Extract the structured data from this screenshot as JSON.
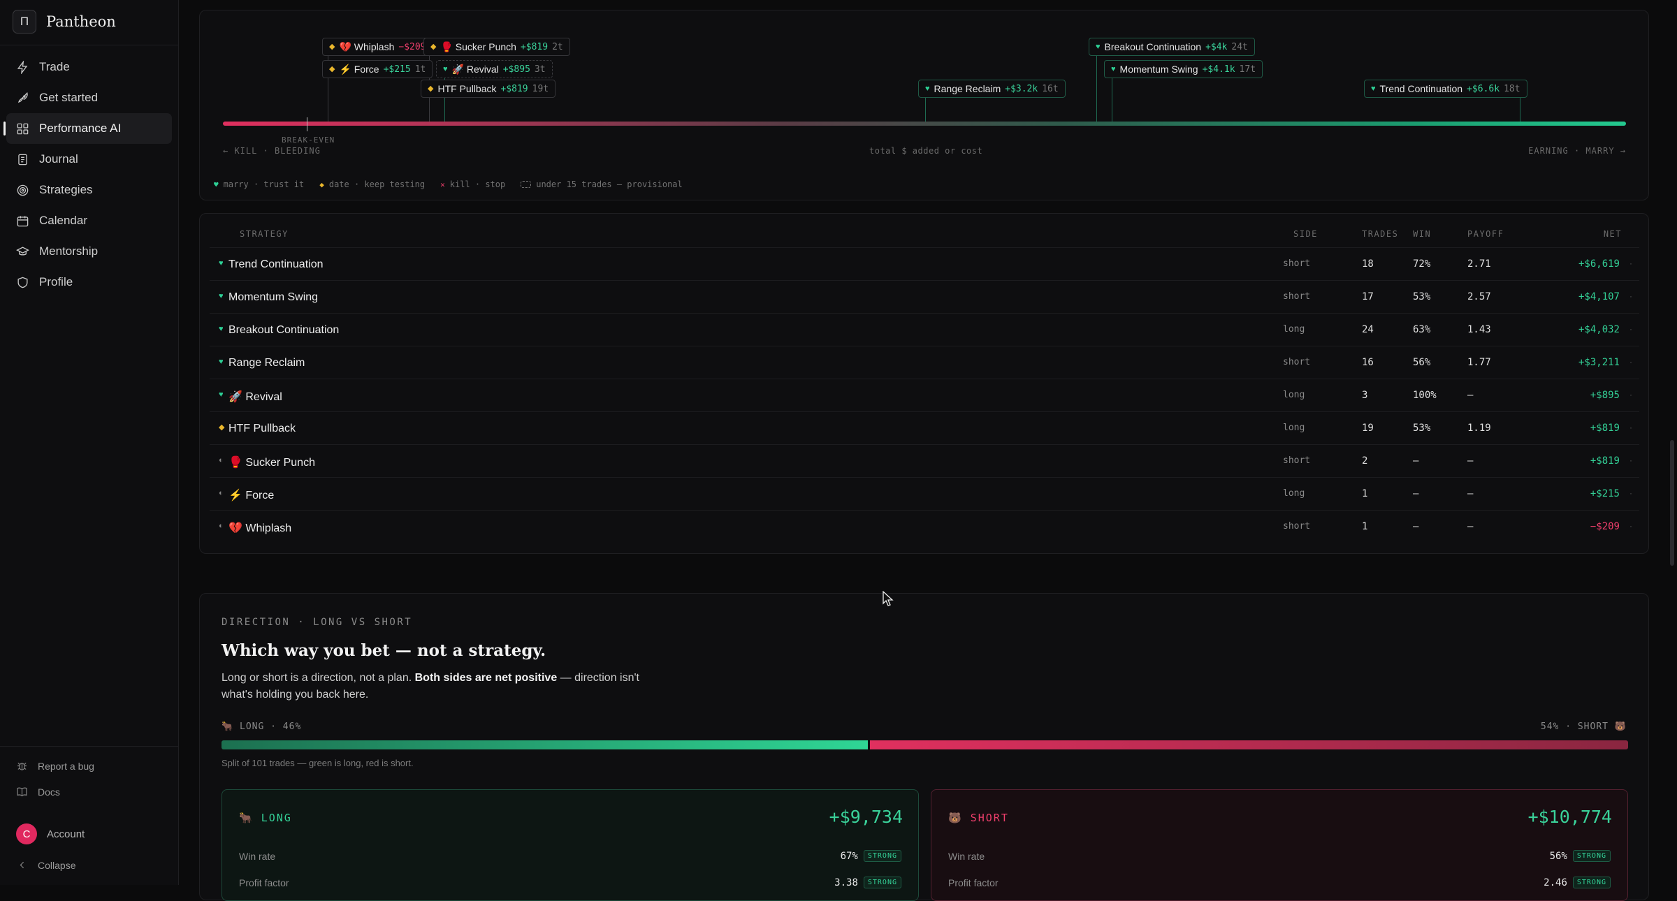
{
  "app": {
    "name": "Pantheon",
    "logo_glyph": "П"
  },
  "nav": [
    {
      "label": "Trade",
      "icon": "bolt-icon"
    },
    {
      "label": "Get started",
      "icon": "rocket-icon"
    },
    {
      "label": "Performance AI",
      "icon": "grid-icon",
      "active": true
    },
    {
      "label": "Journal",
      "icon": "journal-icon"
    },
    {
      "label": "Strategies",
      "icon": "target-icon"
    },
    {
      "label": "Calendar",
      "icon": "calendar-icon"
    },
    {
      "label": "Mentorship",
      "icon": "graduation-cap-icon"
    },
    {
      "label": "Profile",
      "icon": "shield-icon"
    }
  ],
  "sidebar_footer": {
    "report_bug": "Report a bug",
    "docs": "Docs",
    "account": "Account",
    "avatar_initial": "C",
    "collapse": "Collapse"
  },
  "colors": {
    "accent_green": "#33d096",
    "accent_red": "#ef3f6c",
    "date_amber": "#eab72d"
  },
  "map": {
    "chips": [
      {
        "name": "💔 Whiplash",
        "net": "−$209",
        "trades": "",
        "verdict": "date",
        "neg": true
      },
      {
        "name": "🥊 Sucker Punch",
        "net": "+$819",
        "trades": "2t",
        "verdict": "date"
      },
      {
        "name": "⚡ Force",
        "net": "+$215",
        "trades": "1t",
        "verdict": "date"
      },
      {
        "name": "🚀 Revival",
        "net": "+$895",
        "trades": "3t",
        "verdict": "marry"
      },
      {
        "name": "HTF Pullback",
        "net": "+$819",
        "trades": "19t",
        "verdict": "date"
      },
      {
        "name": "Range Reclaim",
        "net": "+$3.2k",
        "trades": "16t",
        "verdict": "marry"
      },
      {
        "name": "Breakout Continuation",
        "net": "+$4k",
        "trades": "24t",
        "verdict": "marry"
      },
      {
        "name": "Momentum Swing",
        "net": "+$4.1k",
        "trades": "17t",
        "verdict": "marry"
      },
      {
        "name": "Trend Continuation",
        "net": "+$6.6k",
        "trades": "18t",
        "verdict": "marry"
      }
    ],
    "break_even_label": "BREAK-EVEN",
    "left_label": "← KILL · BLEEDING",
    "center_label": "total $ added or cost",
    "right_label": "EARNING · MARRY →",
    "legend": {
      "marry": "marry · trust it",
      "date": "date · keep testing",
      "kill": "kill · stop",
      "provisional": "under 15 trades — provisional"
    }
  },
  "table": {
    "headers": {
      "strategy": "STRATEGY",
      "side": "SIDE",
      "trades": "TRADES",
      "win": "WIN",
      "payoff": "PAYOFF",
      "net": "NET"
    },
    "rows": [
      {
        "verdict": "marry",
        "name": "Trend Continuation",
        "side": "short",
        "trades": "18",
        "win": "72%",
        "payoff": "2.71",
        "net": "+$6,619"
      },
      {
        "verdict": "marry",
        "name": "Momentum Swing",
        "side": "short",
        "trades": "17",
        "win": "53%",
        "payoff": "2.57",
        "net": "+$4,107"
      },
      {
        "verdict": "marry",
        "name": "Breakout Continuation",
        "side": "long",
        "trades": "24",
        "win": "63%",
        "payoff": "1.43",
        "net": "+$4,032"
      },
      {
        "verdict": "marry",
        "name": "Range Reclaim",
        "side": "short",
        "trades": "16",
        "win": "56%",
        "payoff": "1.77",
        "net": "+$3,211"
      },
      {
        "verdict": "marry",
        "name": "🚀 Revival",
        "side": "long",
        "trades": "3",
        "win": "100%",
        "payoff": "—",
        "net": "+$895"
      },
      {
        "verdict": "date",
        "name": "HTF Pullback",
        "side": "long",
        "trades": "19",
        "win": "53%",
        "payoff": "1.19",
        "net": "+$819"
      },
      {
        "verdict": "half",
        "name": "🥊 Sucker Punch",
        "side": "short",
        "trades": "2",
        "win": "—",
        "payoff": "—",
        "net": "+$819"
      },
      {
        "verdict": "half",
        "name": "⚡ Force",
        "side": "long",
        "trades": "1",
        "win": "—",
        "payoff": "—",
        "net": "+$215"
      },
      {
        "verdict": "half",
        "name": "💔 Whiplash",
        "side": "short",
        "trades": "1",
        "win": "—",
        "payoff": "—",
        "net": "−$209"
      }
    ],
    "row_dot": "·"
  },
  "direction": {
    "eyebrow": "DIRECTION · LONG VS SHORT",
    "title": "Which way you bet — not a strategy.",
    "desc_start": "Long or short is a direction, not a plan. ",
    "desc_bold": "Both sides are net positive",
    "desc_end": " — direction isn't what's holding you back here.",
    "long_label": "🐂 LONG · 46%",
    "short_label": "54% · SHORT 🐻",
    "long_share": 0.46,
    "note": "Split of 101 trades — green is long, red is short.",
    "long": {
      "label": "🐂 LONG",
      "net": "+$9,734",
      "win_rate_label": "Win rate",
      "win_rate": "67%",
      "win_badge": "STRONG",
      "pf_label": "Profit factor",
      "pf": "3.38",
      "pf_badge": "STRONG"
    },
    "short": {
      "label": "🐻 SHORT",
      "net": "+$10,774",
      "win_rate_label": "Win rate",
      "win_rate": "56%",
      "win_badge": "STRONG",
      "pf_label": "Profit factor",
      "pf": "2.46",
      "pf_badge": "STRONG"
    }
  }
}
